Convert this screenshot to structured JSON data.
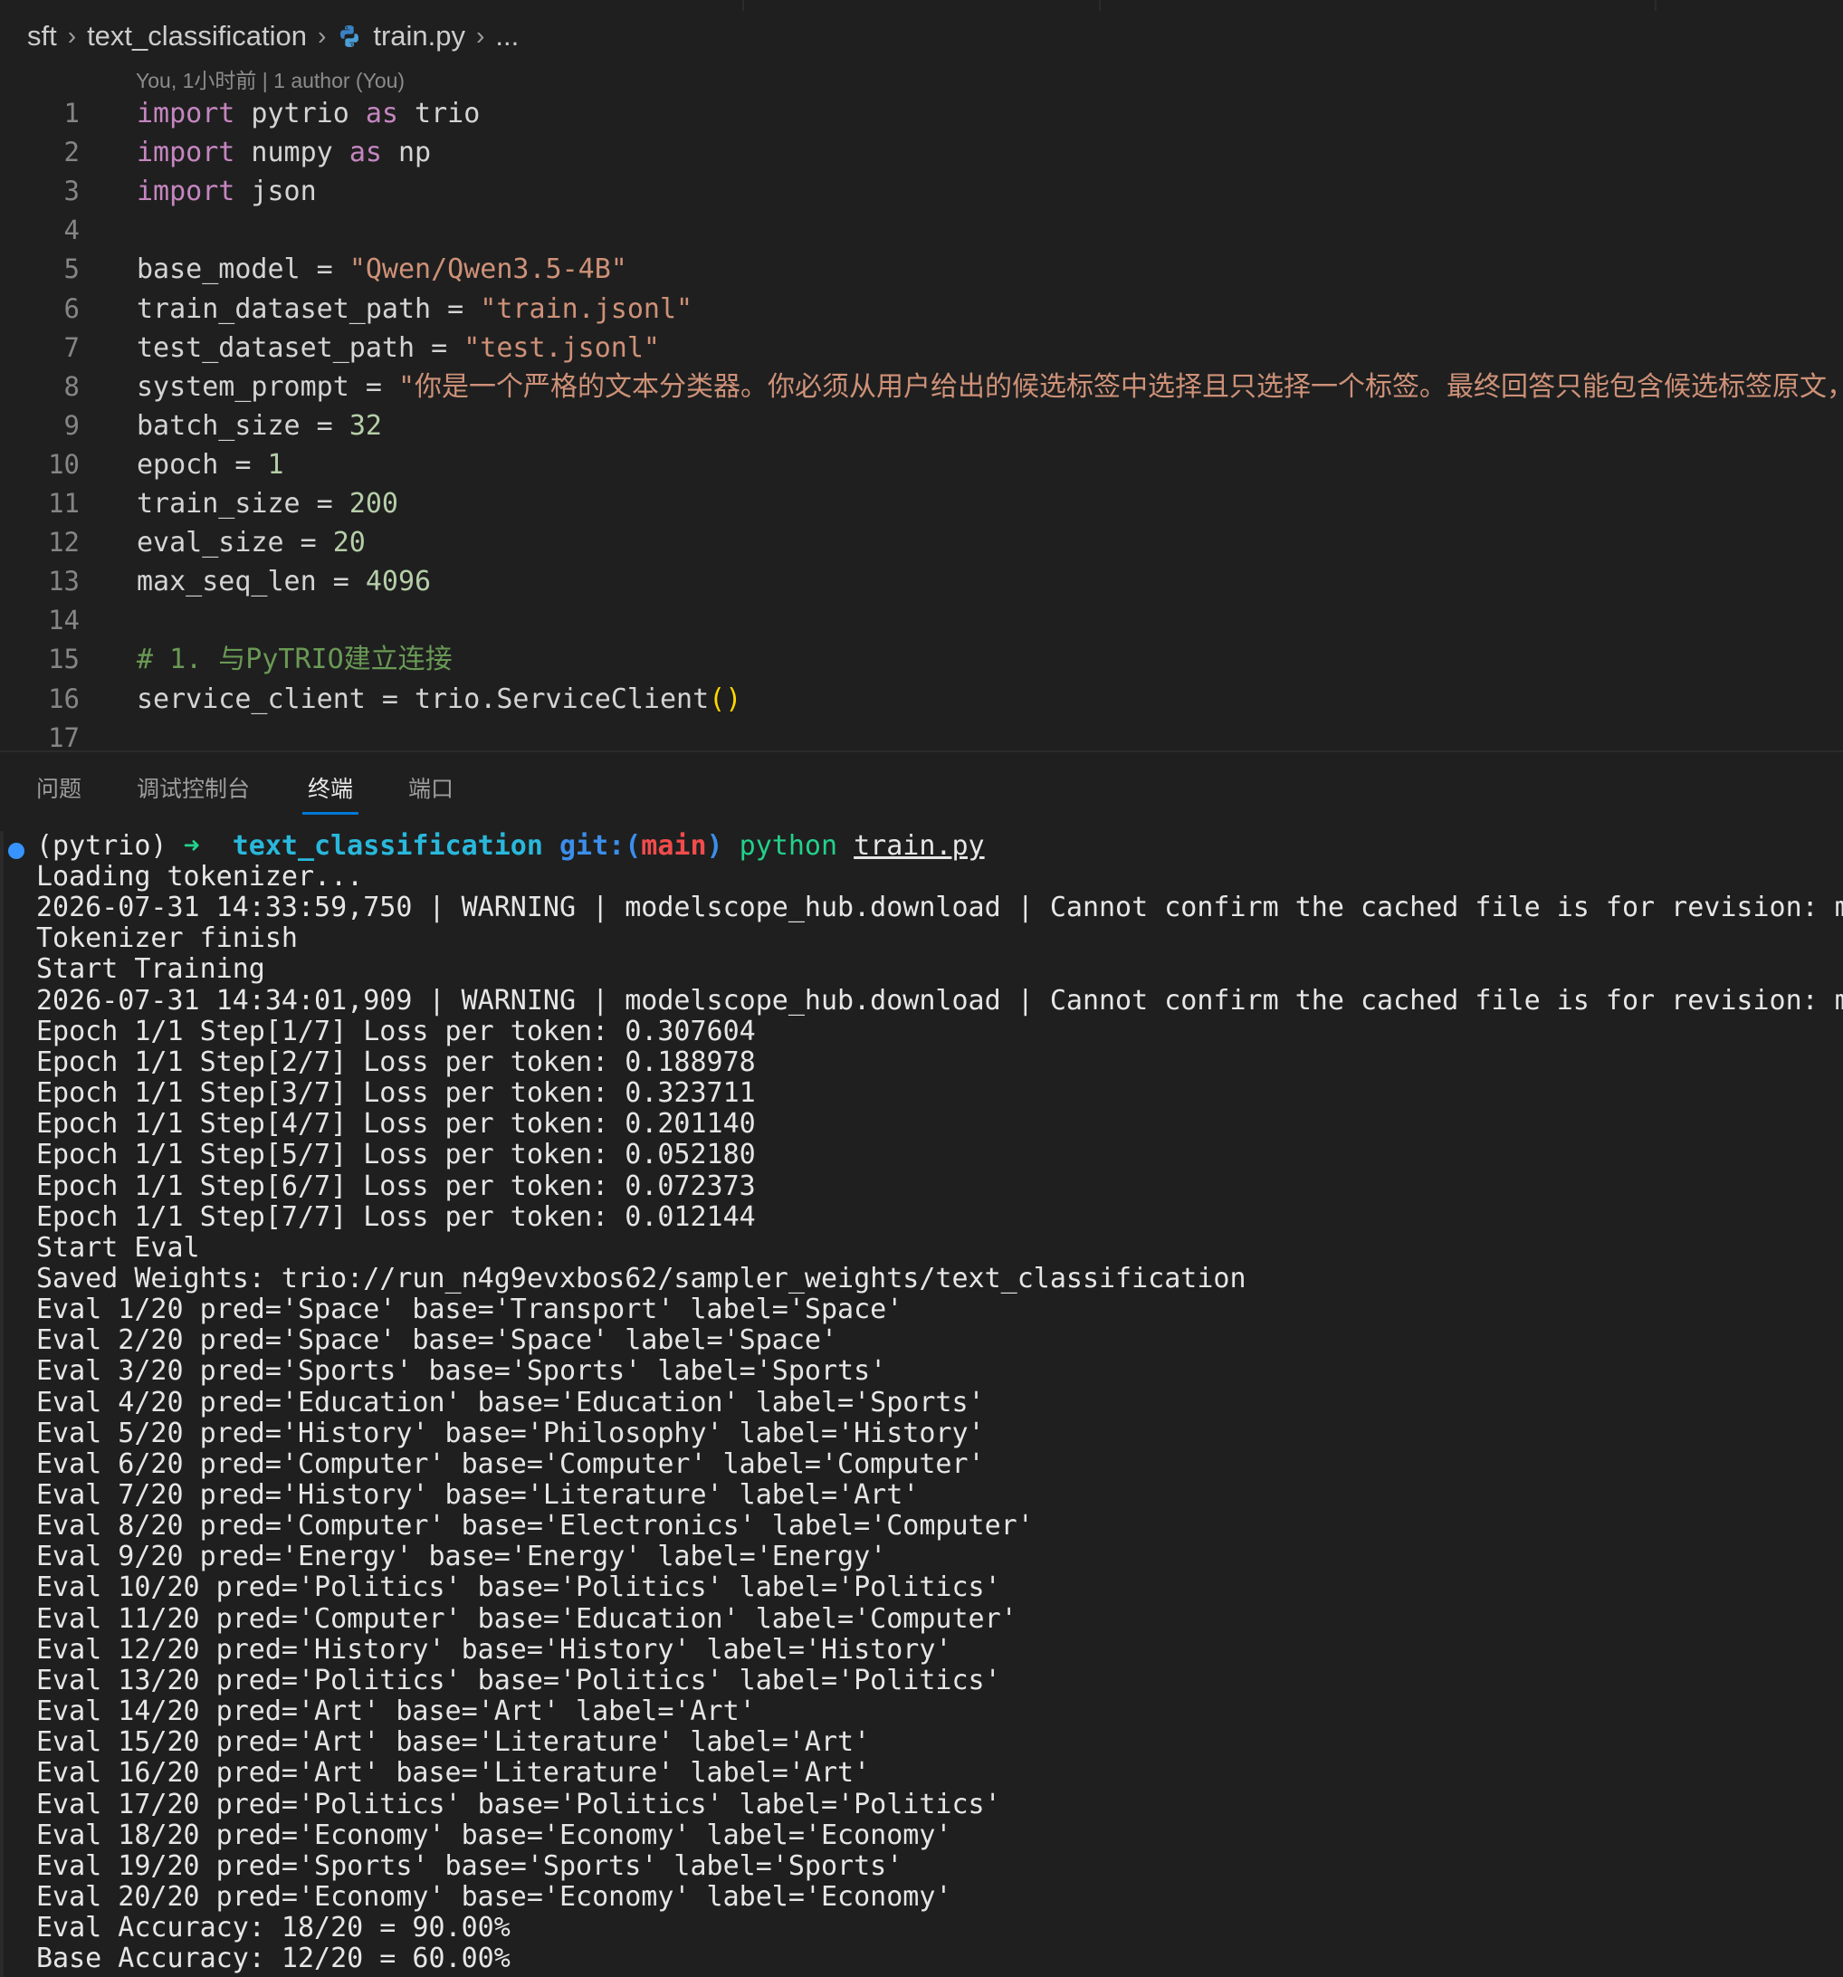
{
  "breadcrumb": {
    "items": [
      "sft",
      "text_classification",
      "train.py",
      "..."
    ]
  },
  "blame": "You, 1小时前 | 1 author (You)",
  "editor": {
    "lines": [
      {
        "n": "1",
        "tokens": [
          {
            "t": "import",
            "c": "kw"
          },
          {
            "t": " pytrio "
          },
          {
            "t": "as",
            "c": "kw"
          },
          {
            "t": " trio"
          }
        ]
      },
      {
        "n": "2",
        "tokens": [
          {
            "t": "import",
            "c": "kw"
          },
          {
            "t": " numpy "
          },
          {
            "t": "as",
            "c": "kw"
          },
          {
            "t": " np"
          }
        ]
      },
      {
        "n": "3",
        "tokens": [
          {
            "t": "import",
            "c": "kw"
          },
          {
            "t": " json"
          }
        ]
      },
      {
        "n": "4",
        "tokens": []
      },
      {
        "n": "5",
        "tokens": [
          {
            "t": "base_model = "
          },
          {
            "t": "\"Qwen/Qwen3.5-4B\"",
            "c": "str"
          }
        ]
      },
      {
        "n": "6",
        "tokens": [
          {
            "t": "train_dataset_path = "
          },
          {
            "t": "\"train.jsonl\"",
            "c": "str"
          }
        ]
      },
      {
        "n": "7",
        "tokens": [
          {
            "t": "test_dataset_path = "
          },
          {
            "t": "\"test.jsonl\"",
            "c": "str"
          }
        ]
      },
      {
        "n": "8",
        "tokens": [
          {
            "t": "system_prompt = "
          },
          {
            "t": "\"你是一个严格的文本分类器。你必须从用户给出的候选标签中选择且只选择一个标签。最终回答只能包含候选标签原文，不要解",
            "c": "str"
          }
        ]
      },
      {
        "n": "9",
        "tokens": [
          {
            "t": "batch_size = "
          },
          {
            "t": "32",
            "c": "num"
          }
        ]
      },
      {
        "n": "10",
        "tokens": [
          {
            "t": "epoch = "
          },
          {
            "t": "1",
            "c": "num"
          }
        ]
      },
      {
        "n": "11",
        "tokens": [
          {
            "t": "train_size = "
          },
          {
            "t": "200",
            "c": "num"
          }
        ]
      },
      {
        "n": "12",
        "tokens": [
          {
            "t": "eval_size = "
          },
          {
            "t": "20",
            "c": "num"
          }
        ]
      },
      {
        "n": "13",
        "tokens": [
          {
            "t": "max_seq_len = "
          },
          {
            "t": "4096",
            "c": "num"
          }
        ]
      },
      {
        "n": "14",
        "tokens": []
      },
      {
        "n": "15",
        "tokens": [
          {
            "t": "# 1. 与PyTRIO建立连接",
            "c": "cmt"
          }
        ]
      },
      {
        "n": "16",
        "tokens": [
          {
            "t": "service_client = trio.ServiceClient"
          },
          {
            "t": "()",
            "c": "paren"
          }
        ]
      },
      {
        "n": "17",
        "tokens": []
      }
    ]
  },
  "panel": {
    "tabs": [
      "问题",
      "调试控制台",
      "终端",
      "端口"
    ],
    "active_tab": "终端"
  },
  "terminal": {
    "prompt": {
      "env": "(pytrio)",
      "arrow": "➜",
      "dir": "text_classification",
      "git_prefix": "git:(",
      "branch": "main",
      "git_suffix": ")",
      "cmd": "python",
      "arg": "train.py"
    },
    "lines": [
      "Loading tokenizer...",
      "2026-07-31 14:33:59,750 | WARNING | modelscope_hub.download | Cannot confirm the cached file is for revision: master",
      "Tokenizer finish",
      "Start Training",
      "2026-07-31 14:34:01,909 | WARNING | modelscope_hub.download | Cannot confirm the cached file is for revision: master",
      "Epoch 1/1 Step[1/7] Loss per token: 0.307604",
      "Epoch 1/1 Step[2/7] Loss per token: 0.188978",
      "Epoch 1/1 Step[3/7] Loss per token: 0.323711",
      "Epoch 1/1 Step[4/7] Loss per token: 0.201140",
      "Epoch 1/1 Step[5/7] Loss per token: 0.052180",
      "Epoch 1/1 Step[6/7] Loss per token: 0.072373",
      "Epoch 1/1 Step[7/7] Loss per token: 0.012144",
      "Start Eval",
      "Saved Weights: trio://run_n4g9evxbos62/sampler_weights/text_classification",
      "Eval 1/20 pred='Space' base='Transport' label='Space'",
      "Eval 2/20 pred='Space' base='Space' label='Space'",
      "Eval 3/20 pred='Sports' base='Sports' label='Sports'",
      "Eval 4/20 pred='Education' base='Education' label='Sports'",
      "Eval 5/20 pred='History' base='Philosophy' label='History'",
      "Eval 6/20 pred='Computer' base='Computer' label='Computer'",
      "Eval 7/20 pred='History' base='Literature' label='Art'",
      "Eval 8/20 pred='Computer' base='Electronics' label='Computer'",
      "Eval 9/20 pred='Energy' base='Energy' label='Energy'",
      "Eval 10/20 pred='Politics' base='Politics' label='Politics'",
      "Eval 11/20 pred='Computer' base='Education' label='Computer'",
      "Eval 12/20 pred='History' base='History' label='History'",
      "Eval 13/20 pred='Politics' base='Politics' label='Politics'",
      "Eval 14/20 pred='Art' base='Art' label='Art'",
      "Eval 15/20 pred='Art' base='Literature' label='Art'",
      "Eval 16/20 pred='Art' base='Literature' label='Art'",
      "Eval 17/20 pred='Politics' base='Politics' label='Politics'",
      "Eval 18/20 pred='Economy' base='Economy' label='Economy'",
      "Eval 19/20 pred='Sports' base='Sports' label='Sports'",
      "Eval 20/20 pred='Economy' base='Economy' label='Economy'",
      "Eval Accuracy: 18/20 = 90.00%",
      "Base Accuracy: 12/20 = 60.00%"
    ]
  },
  "colors": {
    "background": "#1f1f1f",
    "keyword": "#c586c0",
    "string": "#ce9178",
    "number": "#b5cea8",
    "comment": "#6a9955",
    "accent": "#0078d4"
  }
}
